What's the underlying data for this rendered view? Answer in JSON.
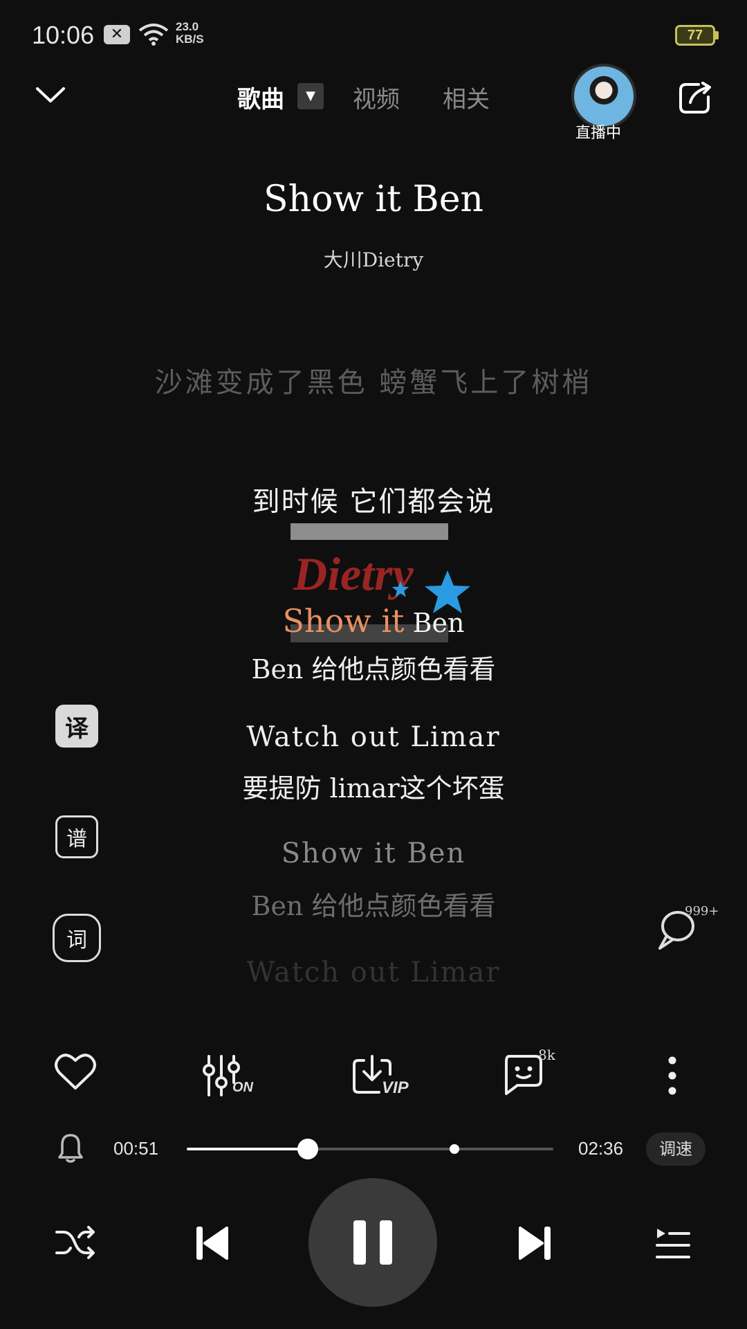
{
  "status_bar": {
    "time": "10:06",
    "notification_icon": "close-x-icon",
    "net_speed_value": "23.0",
    "net_speed_unit": "KB/S",
    "battery": "77"
  },
  "header": {
    "tabs": [
      {
        "label": "歌曲",
        "active": true
      },
      {
        "label": "视频",
        "active": false
      },
      {
        "label": "相关",
        "active": false
      }
    ],
    "live_label": "直播中"
  },
  "song": {
    "title": "Show it Ben",
    "artist": "大川Dietry"
  },
  "lyrics": {
    "line1": "沙滩变成了黑色 螃蟹飞上了树梢",
    "line2": "到时候 它们都会说",
    "active_highlight": "Show it",
    "active_rest": " Ben",
    "active_translation": "Ben 给他点颜色看看",
    "line4_en": "Watch out Limar",
    "line4_tr": "要提防 limar这个坏蛋",
    "line5_en": "Show it Ben",
    "line5_tr": "Ben 给他点颜色看看",
    "line6_en": "Watch out Limar"
  },
  "watermark": {
    "logo_text": "Dietry"
  },
  "side_tools": {
    "translate": "译",
    "score": "谱",
    "lyrics": "词",
    "comment_count": "999+"
  },
  "actions": {
    "equalizer_badge": "ON",
    "download_badge": "VIP",
    "comments_badge": "8k"
  },
  "progress": {
    "current": "00:51",
    "total": "02:36",
    "played_fraction": 0.33,
    "marker_fraction": 0.73,
    "speed_label": "调速"
  },
  "colors": {
    "background": "#0f0f0f",
    "lyric_highlight": "#e79062",
    "battery": "#c6c25a"
  }
}
